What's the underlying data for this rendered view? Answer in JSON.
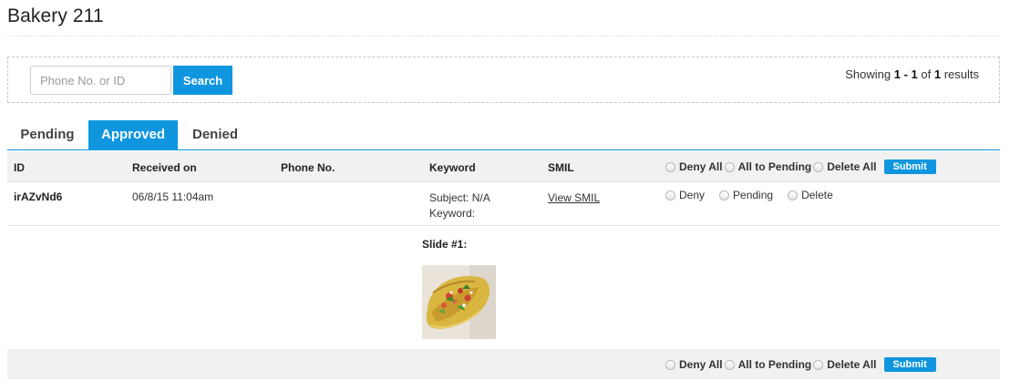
{
  "page": {
    "title": "Bakery 211"
  },
  "search": {
    "placeholder": "Phone No. or ID",
    "button_label": "Search",
    "results_prefix": "Showing ",
    "results_from": "1",
    "results_sep": " - ",
    "results_to": "1",
    "results_of": " of ",
    "results_total": "1",
    "results_suffix": " results"
  },
  "tabs": [
    {
      "label": "Pending",
      "active": false
    },
    {
      "label": "Approved",
      "active": true
    },
    {
      "label": "Denied",
      "active": false
    }
  ],
  "table": {
    "headers": {
      "id": "ID",
      "received": "Received on",
      "phone": "Phone No.",
      "keyword": "Keyword",
      "smil": "SMIL"
    },
    "bulk_actions": {
      "deny_all": "Deny All",
      "all_to_pending": "All to Pending",
      "delete_all": "Delete All",
      "submit": "Submit"
    },
    "rows": [
      {
        "id": "irAZvNd6",
        "received": "06/8/15 11:04am",
        "phone": "",
        "subject_line": "Subject: N/A",
        "keyword_line": "Keyword:",
        "smil_link": "View SMIL",
        "actions": {
          "deny": "Deny",
          "pending": "Pending",
          "delete": "Delete"
        }
      }
    ]
  },
  "slide": {
    "label": "Slide #1:",
    "image": "taco-photo"
  },
  "colors": {
    "accent": "#0f96df",
    "header_bg": "#f1f1f1"
  }
}
